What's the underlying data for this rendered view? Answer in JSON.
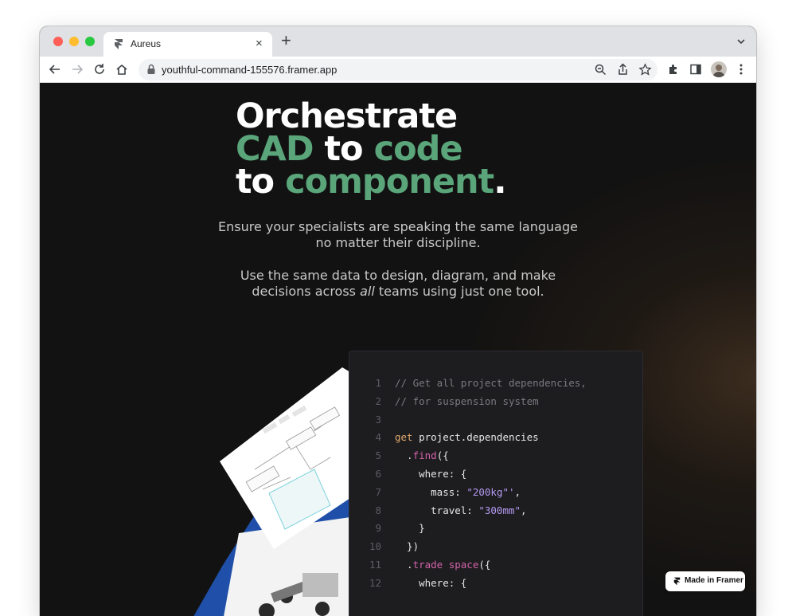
{
  "browser": {
    "tab_title": "Aureus",
    "new_tab_label": "+",
    "close_tab_label": "×",
    "url": "youthful-command-155576.framer.app"
  },
  "hero": {
    "line1": "Orchestrate",
    "line2_a": "CAD",
    "line2_b": " to ",
    "line2_c": "code",
    "line3_a": "to ",
    "line3_b": "component",
    "line3_c": ".",
    "accent_color": "#5aa57a",
    "paragraph1": "Ensure your specialists are speaking the same language no matter their discipline.",
    "paragraph2_pre": "Use the same data to design, diagram, and make decisions across ",
    "paragraph2_em": "all",
    "paragraph2_post": " teams using just one tool."
  },
  "code": {
    "lines": [
      {
        "n": "1",
        "parts": [
          {
            "t": "// Get all project dependencies,",
            "c": "c-comment"
          }
        ]
      },
      {
        "n": "2",
        "parts": [
          {
            "t": "// for suspension system",
            "c": "c-comment"
          }
        ]
      },
      {
        "n": "3",
        "parts": []
      },
      {
        "n": "4",
        "parts": [
          {
            "t": "get",
            "c": "c-kw"
          },
          {
            "t": " project.dependencies",
            "c": ""
          }
        ]
      },
      {
        "n": "5",
        "parts": [
          {
            "t": "  .",
            "c": ""
          },
          {
            "t": "find",
            "c": "c-fn"
          },
          {
            "t": "({",
            "c": ""
          }
        ]
      },
      {
        "n": "6",
        "parts": [
          {
            "t": "    where: {",
            "c": ""
          }
        ]
      },
      {
        "n": "7",
        "parts": [
          {
            "t": "      mass: ",
            "c": ""
          },
          {
            "t": "\"200kg\"'",
            "c": "c-str"
          },
          {
            "t": ",",
            "c": ""
          }
        ]
      },
      {
        "n": "8",
        "parts": [
          {
            "t": "      travel: ",
            "c": ""
          },
          {
            "t": "\"300mm\"",
            "c": "c-str"
          },
          {
            "t": ",",
            "c": ""
          }
        ]
      },
      {
        "n": "9",
        "parts": [
          {
            "t": "    }",
            "c": ""
          }
        ]
      },
      {
        "n": "10",
        "parts": [
          {
            "t": "  })",
            "c": ""
          }
        ]
      },
      {
        "n": "11",
        "parts": [
          {
            "t": "  .",
            "c": ""
          },
          {
            "t": "trade space",
            "c": "c-fn"
          },
          {
            "t": "({",
            "c": ""
          }
        ]
      },
      {
        "n": "12",
        "parts": [
          {
            "t": "    where: {",
            "c": ""
          }
        ]
      }
    ]
  },
  "badge": {
    "label": "Made in Framer"
  }
}
